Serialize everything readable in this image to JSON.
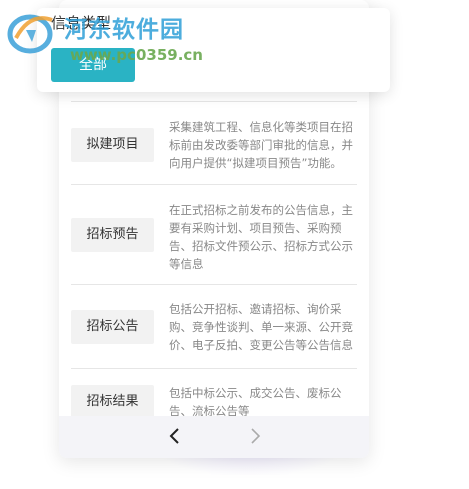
{
  "filter": {
    "title": "信息类型",
    "selected": "全部"
  },
  "watermark": {
    "title": "河东软件园",
    "url": "www.pc0359.cn"
  },
  "items": [
    {
      "label": "拟建项目",
      "desc": "采集建筑工程、信息化等类项目在招标前由发改委等部门审批的信息，并向用户提供“拟建项目预告”功能。"
    },
    {
      "label": "招标预告",
      "desc": "在正式招标之前发布的公告信息，主要有采购计划、项目预告、采购预告、招标文件预公示、招标方式公示等信息"
    },
    {
      "label": "招标公告",
      "desc": "包括公开招标、邀请招标、询价采购、竞争性谈判、单一来源、公开竞价、电子反拍、变更公告等公告信息"
    },
    {
      "label": "招标结果",
      "desc": "包括中标公示、成交公告、废标公告、流标公告等"
    }
  ],
  "nav": {
    "prev_icon": "chevron-left-icon",
    "next_icon": "chevron-right-icon"
  },
  "colors": {
    "accent": "#2ab3c4",
    "button_bg": "#f2f2f2",
    "text_muted": "#888888"
  }
}
